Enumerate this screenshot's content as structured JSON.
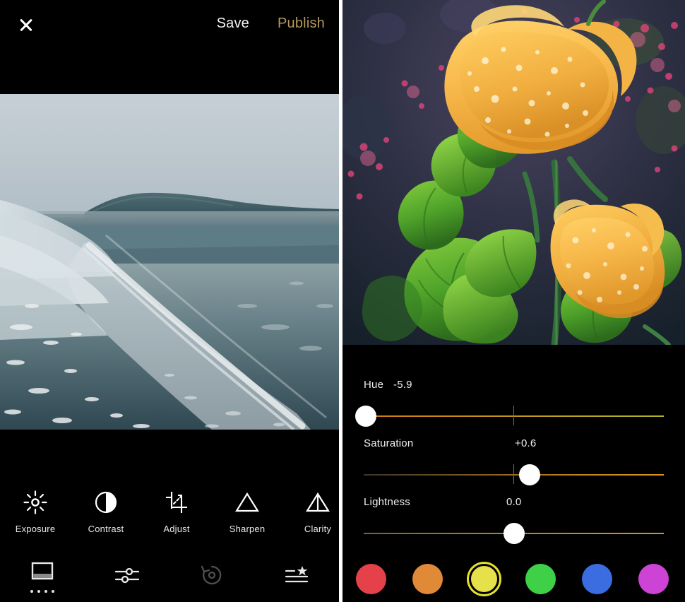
{
  "app": {
    "left_panel": {
      "topbar": {
        "close_icon": "close-icon",
        "save_label": "Save",
        "publish_label": "Publish",
        "publish_color": "#b59a5d"
      },
      "photo": {
        "name": "beach-shoreline-photo",
        "description": "Moody overcast beach with waves on wet sand and distant headland"
      },
      "tools": [
        {
          "label": "Exposure",
          "icon": "sun-icon"
        },
        {
          "label": "Contrast",
          "icon": "contrast-circle-icon"
        },
        {
          "label": "Adjust",
          "icon": "crop-rotate-icon"
        },
        {
          "label": "Sharpen",
          "icon": "triangle-icon"
        },
        {
          "label": "Clarity",
          "icon": "split-triangle-icon"
        }
      ],
      "bottom_nav": [
        {
          "name": "presets",
          "icon": "filter-frame-icon",
          "active": true,
          "dots": 4
        },
        {
          "name": "adjustments",
          "icon": "sliders-icon",
          "active": false
        },
        {
          "name": "history-undo",
          "icon": "undo-clock-icon",
          "active": false
        },
        {
          "name": "recipes",
          "icon": "list-star-icon",
          "active": false
        }
      ]
    },
    "right_panel": {
      "photo": {
        "name": "yellow-poppy-flowers-photo",
        "description": "Two yellow poppies with water droplets over green foliage"
      },
      "sliders": [
        {
          "name": "Hue",
          "value": "-5.9",
          "thumb_pct": 0,
          "tick_pct": 50,
          "track": "hue"
        },
        {
          "name": "Saturation",
          "value": "+0.6",
          "thumb_pct": 55,
          "tick_pct": 50,
          "track": "sat"
        },
        {
          "name": "Lightness",
          "value": "0.0",
          "thumb_pct": 50,
          "tick_pct": 50,
          "track": "light"
        }
      ],
      "swatches": [
        {
          "name": "red",
          "color": "#e4414a",
          "selected": false
        },
        {
          "name": "orange",
          "color": "#e08936",
          "selected": false
        },
        {
          "name": "yellow",
          "color": "#e6e04a",
          "selected": true
        },
        {
          "name": "green",
          "color": "#3ed046",
          "selected": false
        },
        {
          "name": "blue",
          "color": "#3b6de0",
          "selected": false
        },
        {
          "name": "magenta",
          "color": "#cc43d6",
          "selected": false
        }
      ]
    }
  }
}
